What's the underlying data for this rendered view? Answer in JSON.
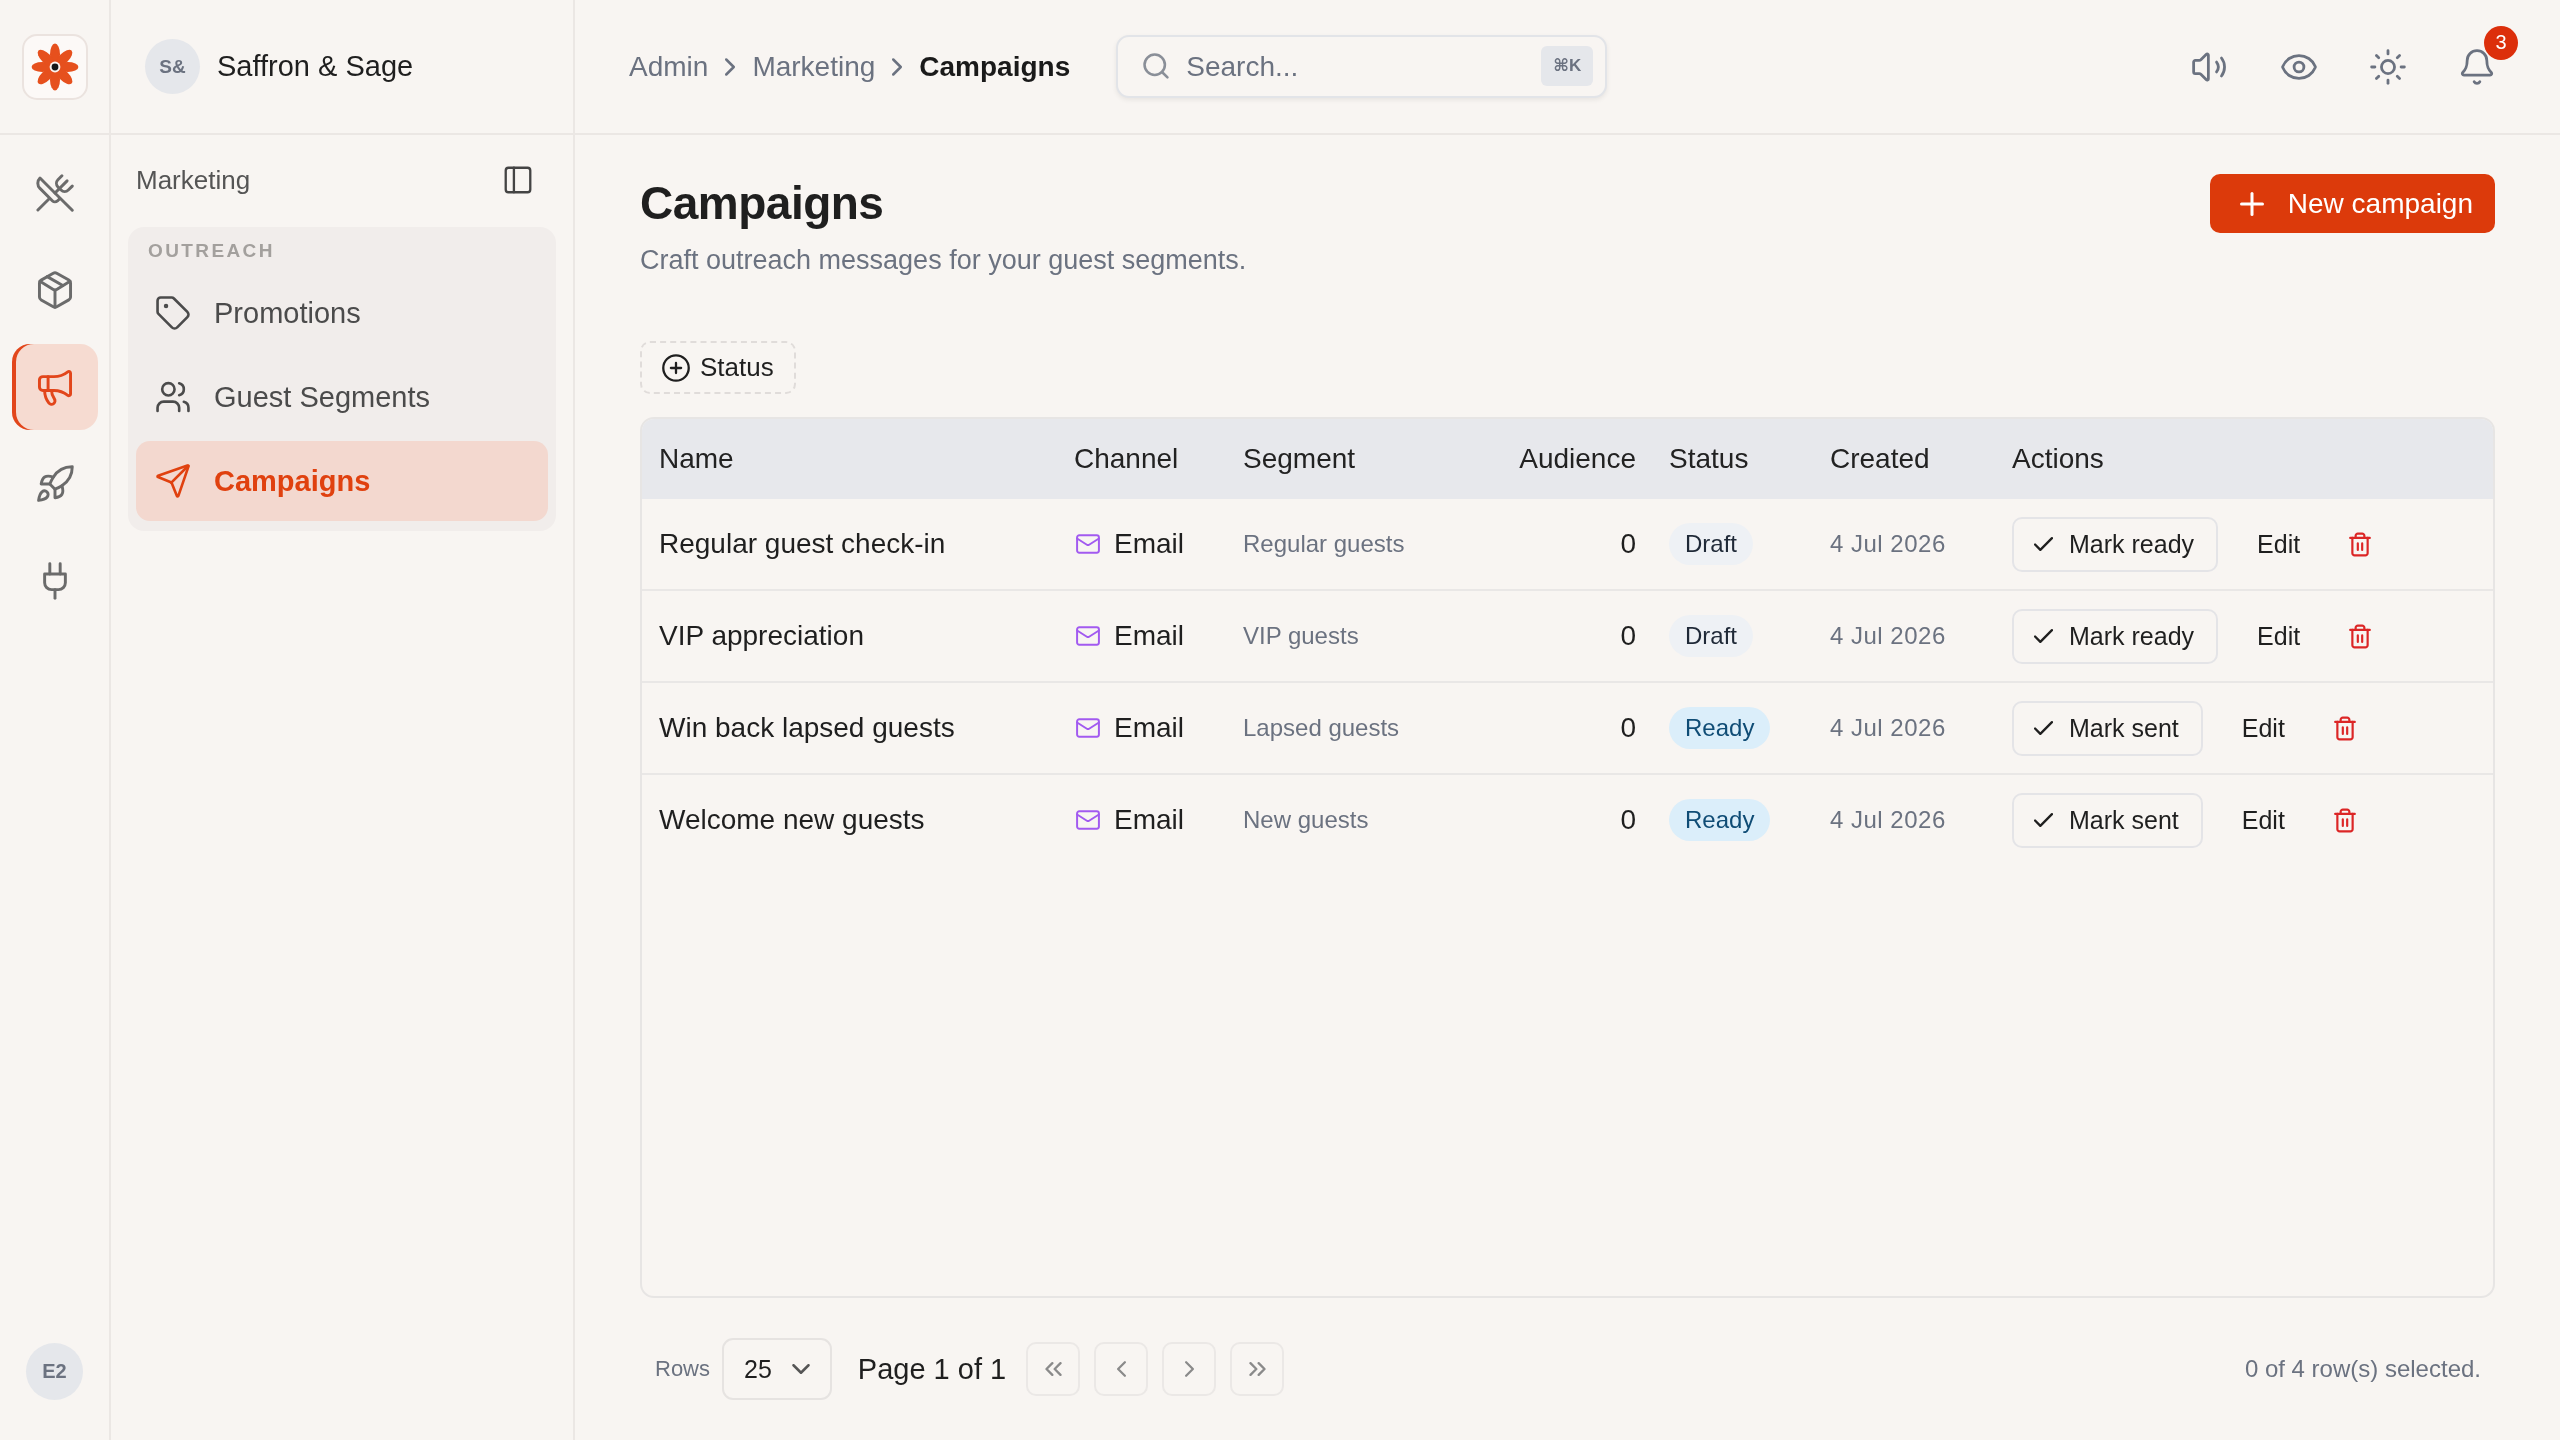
{
  "brand": {
    "initials": "S&",
    "name": "Saffron & Sage"
  },
  "rail": {
    "items": [
      {
        "kind": "utensils",
        "selected": false
      },
      {
        "kind": "package",
        "selected": false
      },
      {
        "kind": "megaphone",
        "selected": true
      },
      {
        "kind": "rocket",
        "selected": false
      },
      {
        "kind": "plug",
        "selected": false
      }
    ],
    "user_initials": "E2"
  },
  "breadcrumb": [
    {
      "label": "Admin",
      "current": false
    },
    {
      "label": "Marketing",
      "current": false
    },
    {
      "label": "Campaigns",
      "current": true
    }
  ],
  "search": {
    "placeholder": "Search...",
    "shortcut": "⌘K"
  },
  "notifications": {
    "count": "3"
  },
  "sidebar": {
    "title": "Marketing",
    "groups": [
      {
        "label": "OUTREACH",
        "items": [
          {
            "label": "Promotions",
            "kind": "tag",
            "selected": false
          },
          {
            "label": "Guest Segments",
            "kind": "users",
            "selected": false
          },
          {
            "label": "Campaigns",
            "kind": "send",
            "selected": true
          }
        ]
      }
    ]
  },
  "page": {
    "title": "Campaigns",
    "subtitle": "Craft outreach messages for your guest segments.",
    "primary_action": "New campaign",
    "filters": [
      "Status"
    ]
  },
  "table": {
    "columns": [
      "Name",
      "Channel",
      "Segment",
      "Audience",
      "Status",
      "Created",
      "Actions"
    ],
    "rows": [
      {
        "name": "Regular guest check-in",
        "channel": "Email",
        "segment": "Regular guests",
        "audience": "0",
        "status": {
          "label": "Draft",
          "kind": "draft"
        },
        "created": "4 Jul 2026",
        "status_action": "Mark ready",
        "edit": "Edit"
      },
      {
        "name": "VIP appreciation",
        "channel": "Email",
        "segment": "VIP guests",
        "audience": "0",
        "status": {
          "label": "Draft",
          "kind": "draft"
        },
        "created": "4 Jul 2026",
        "status_action": "Mark ready",
        "edit": "Edit"
      },
      {
        "name": "Win back lapsed guests",
        "channel": "Email",
        "segment": "Lapsed guests",
        "audience": "0",
        "status": {
          "label": "Ready",
          "kind": "ready"
        },
        "created": "4 Jul 2026",
        "status_action": "Mark sent",
        "edit": "Edit"
      },
      {
        "name": "Welcome new guests",
        "channel": "Email",
        "segment": "New guests",
        "audience": "0",
        "status": {
          "label": "Ready",
          "kind": "ready"
        },
        "created": "4 Jul 2026",
        "status_action": "Mark sent",
        "edit": "Edit"
      }
    ]
  },
  "pagination": {
    "rows_label": "Rows",
    "page_size": "25",
    "page_info": "Page 1 of 1",
    "selection": "0 of 4 row(s) selected."
  }
}
